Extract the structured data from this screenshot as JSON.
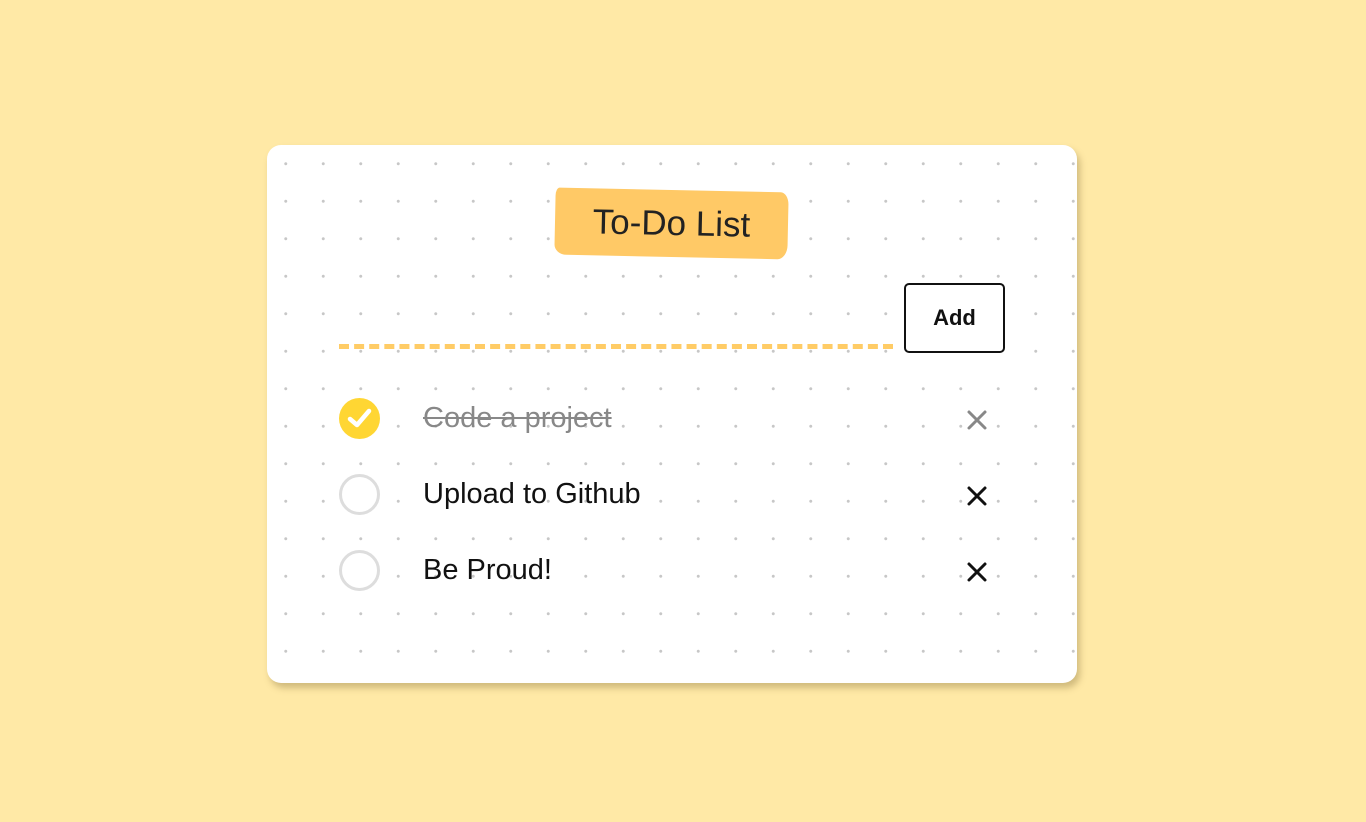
{
  "app": {
    "title": "To-Do List"
  },
  "input": {
    "value": "",
    "placeholder": ""
  },
  "add_button": {
    "label": "Add"
  },
  "todos": [
    {
      "text": "Code a project",
      "done": true
    },
    {
      "text": "Upload to Github",
      "done": false
    },
    {
      "text": "Be Proud!",
      "done": false
    }
  ],
  "icons": {
    "check": "check-icon",
    "delete": "close-icon"
  },
  "colors": {
    "background": "#ffe9a6",
    "accent": "#ffc966",
    "check": "#ffd633",
    "done_text": "#888888"
  }
}
